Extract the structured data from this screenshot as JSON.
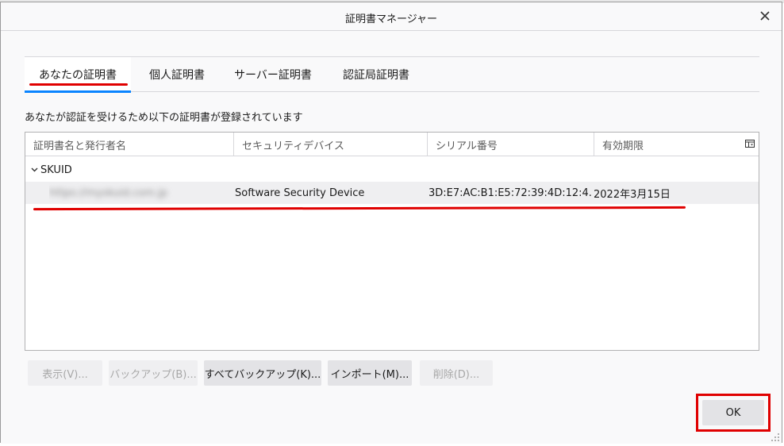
{
  "dialog": {
    "title": "証明書マネージャー",
    "close_icon": "close-icon"
  },
  "tabs": [
    {
      "label": "あなたの証明書",
      "selected": true
    },
    {
      "label": "個人証明書",
      "selected": false
    },
    {
      "label": "サーバー証明書",
      "selected": false
    },
    {
      "label": "認証局証明書",
      "selected": false
    }
  ],
  "description": "あなたが認証を受けるため以下の証明書が登録されています",
  "table": {
    "columns": [
      "証明書名と発行者名",
      "セキュリティデバイス",
      "シリアル番号",
      "有効期限"
    ],
    "column_picker_icon": "column-picker-icon",
    "groups": [
      {
        "label": "SKUID",
        "expanded": true,
        "rows": [
          {
            "name": "https://myskuid.com.jp",
            "device": "Software Security Device",
            "serial": "3D:E7:AC:B1:E5:72:39:4D:12:4...",
            "expires": "2022年3月15日"
          }
        ]
      }
    ]
  },
  "buttons": {
    "view": "表示(V)...",
    "backup": "バックアップ(B)...",
    "backup_all": "すべてバックアップ(K)...",
    "import": "インポート(M)...",
    "delete": "削除(D)...",
    "ok": "OK"
  },
  "colors": {
    "accent": "#0a84ff",
    "annotation": "#e00000"
  }
}
